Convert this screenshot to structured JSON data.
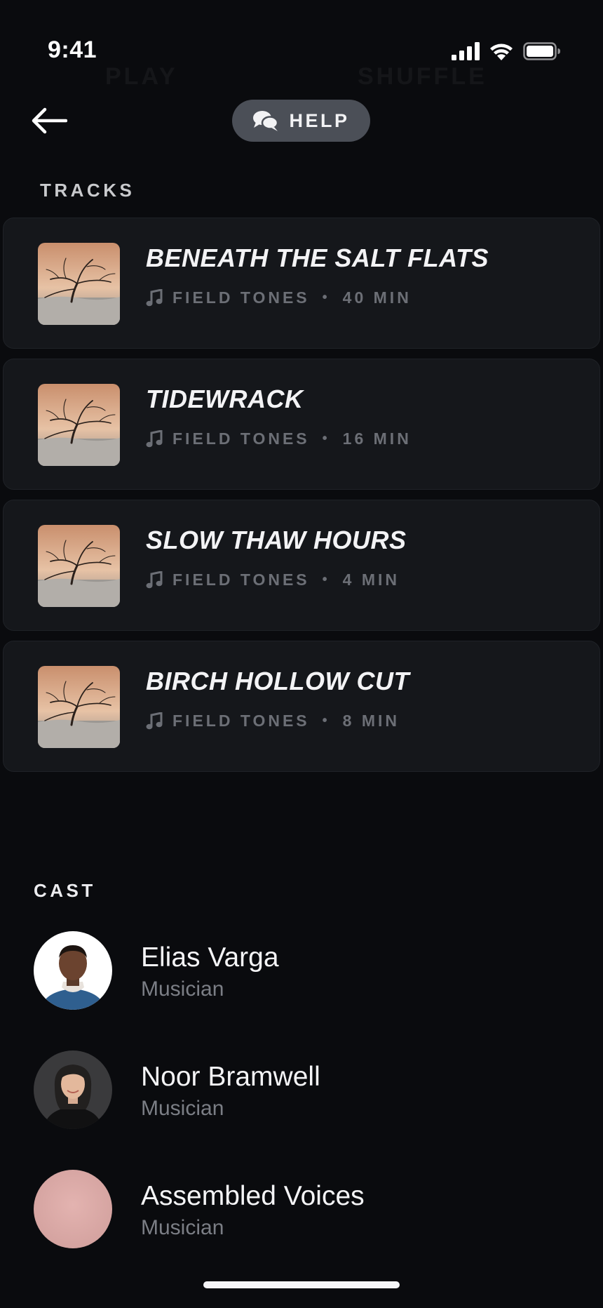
{
  "status_bar": {
    "time": "9:41"
  },
  "header": {
    "ghost_play_label": "PLAY",
    "ghost_shuffle_label": "SHUFFLE",
    "help_label": "HELP"
  },
  "tracks": {
    "title": "TRACKS",
    "items": [
      {
        "title": "BENEATH THE SALT FLATS",
        "artist": "FIELD TONES",
        "duration": "40 MIN"
      },
      {
        "title": "TIDEWRACK",
        "artist": "FIELD TONES",
        "duration": "16 MIN"
      },
      {
        "title": "SLOW THAW HOURS",
        "artist": "FIELD TONES",
        "duration": "4 MIN"
      },
      {
        "title": "BIRCH HOLLOW CUT",
        "artist": "FIELD TONES",
        "duration": "8 MIN"
      }
    ]
  },
  "cast": {
    "title": "CAST",
    "items": [
      {
        "name": "Elias Varga",
        "role": "Musician"
      },
      {
        "name": "Noor Bramwell",
        "role": "Musician"
      },
      {
        "name": "Assembled Voices",
        "role": "Musician"
      }
    ]
  },
  "colors": {
    "background": "#0a0b0e",
    "card": "#15171b",
    "help_pill": "#4b4f57",
    "muted_text": "#6c6f76",
    "placeholder_avatar": "#d9a7a4"
  },
  "icons": {
    "status": [
      "signal-icon",
      "wifi-icon",
      "battery-icon"
    ],
    "back": "arrow-left-icon",
    "help": "chat-bubbles-icon",
    "track_meta": "music-note-icon"
  }
}
